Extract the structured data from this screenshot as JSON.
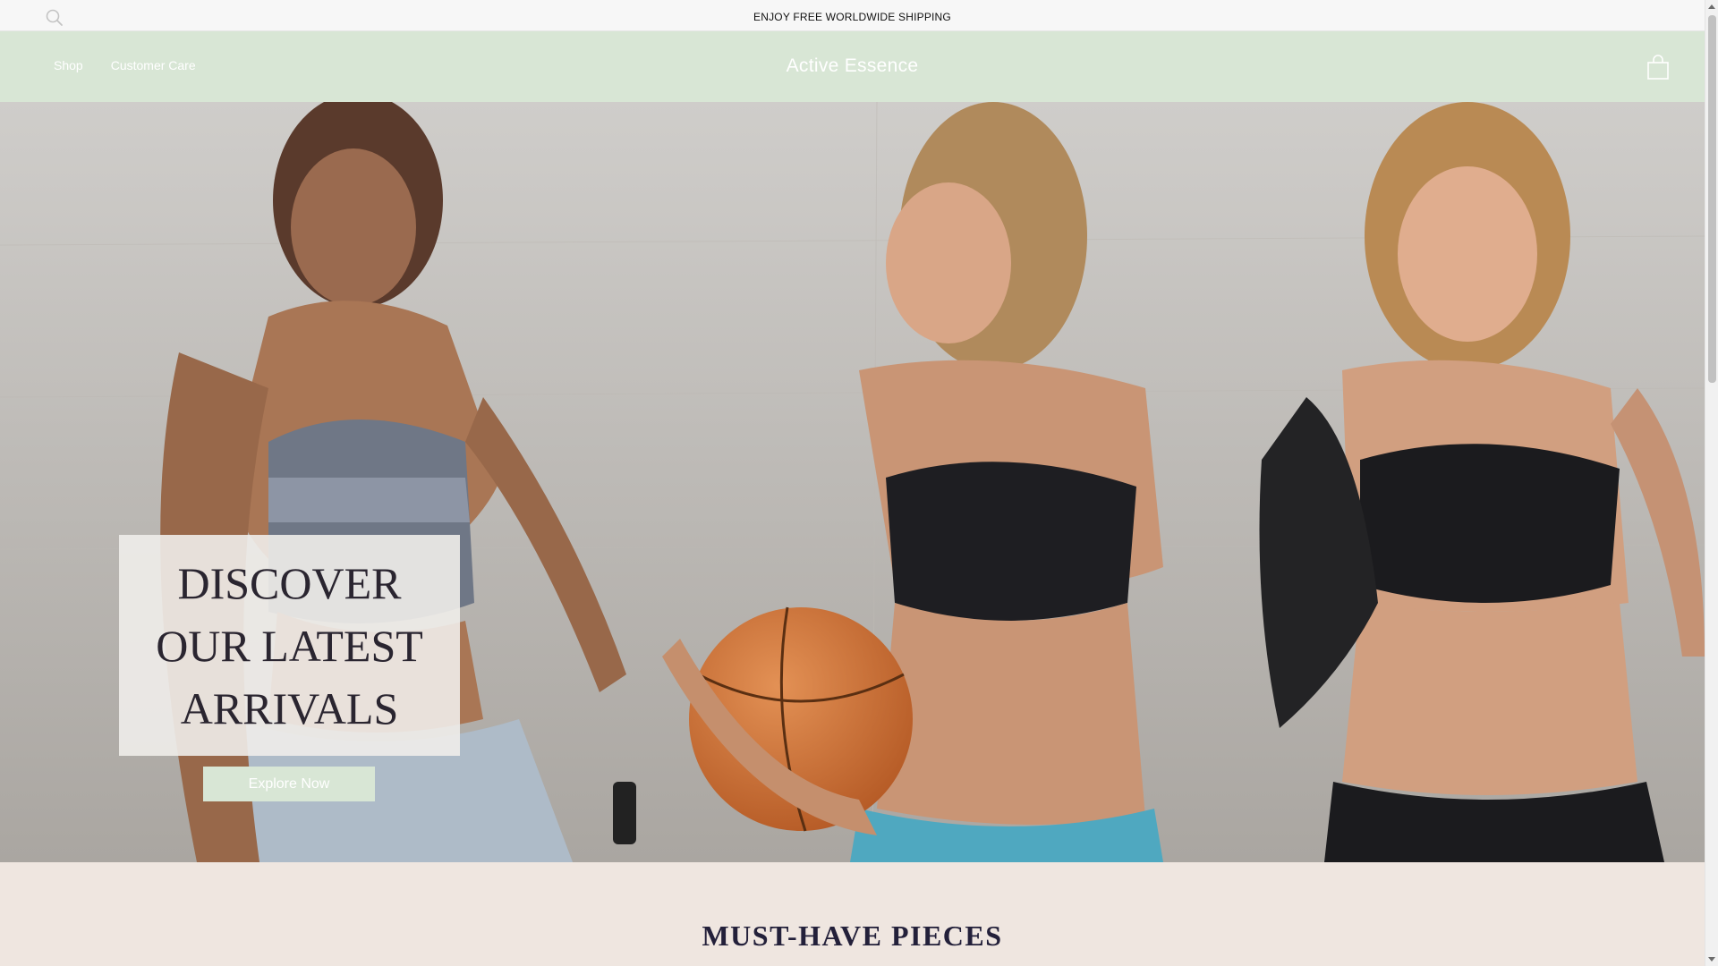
{
  "announcement": {
    "text": "ENJOY FREE WORLDWIDE SHIPPING",
    "search_icon": "search-icon"
  },
  "header": {
    "nav": [
      {
        "label": "Shop"
      },
      {
        "label": "Customer Care"
      }
    ],
    "brand": "Active Essence",
    "cart_icon": "shopping-bag-icon"
  },
  "hero": {
    "headline": "DISCOVER OUR LATEST ARRIVALS",
    "cta_label": "Explore Now"
  },
  "sections": {
    "featured_title": "MUST-HAVE PIECES"
  },
  "colors": {
    "header_bg": "#d8e6d5",
    "announcement_bg": "#f7f7f7",
    "page_bg": "#efe6e0",
    "headline_text": "#2a2530",
    "cta_bg": "#d8e6d5"
  }
}
